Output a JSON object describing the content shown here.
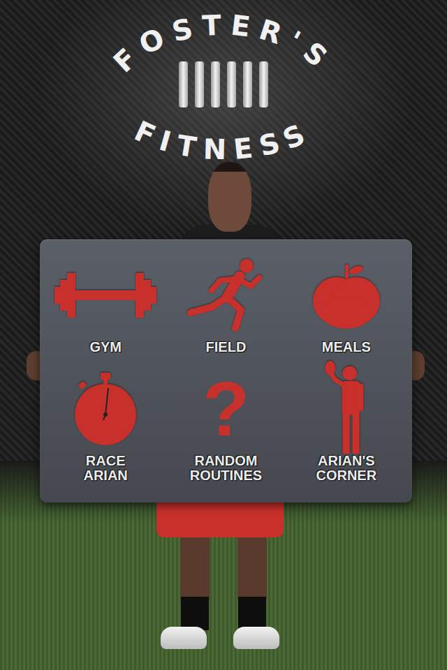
{
  "app": {
    "title_top": "FOSTER'S",
    "title_bottom": "FITNESS"
  },
  "menu": [
    {
      "label": "GYM",
      "kind": "dumbbell"
    },
    {
      "label": "FIELD",
      "kind": "runner"
    },
    {
      "label": "MEALS",
      "kind": "apple"
    },
    {
      "label": "RACE ARIAN",
      "kind": "stopwatch"
    },
    {
      "label": "RANDOM ROUTINES",
      "kind": "glyph",
      "glyph": "?"
    },
    {
      "label": "ARIAN'S CORNER",
      "kind": "player"
    }
  ]
}
